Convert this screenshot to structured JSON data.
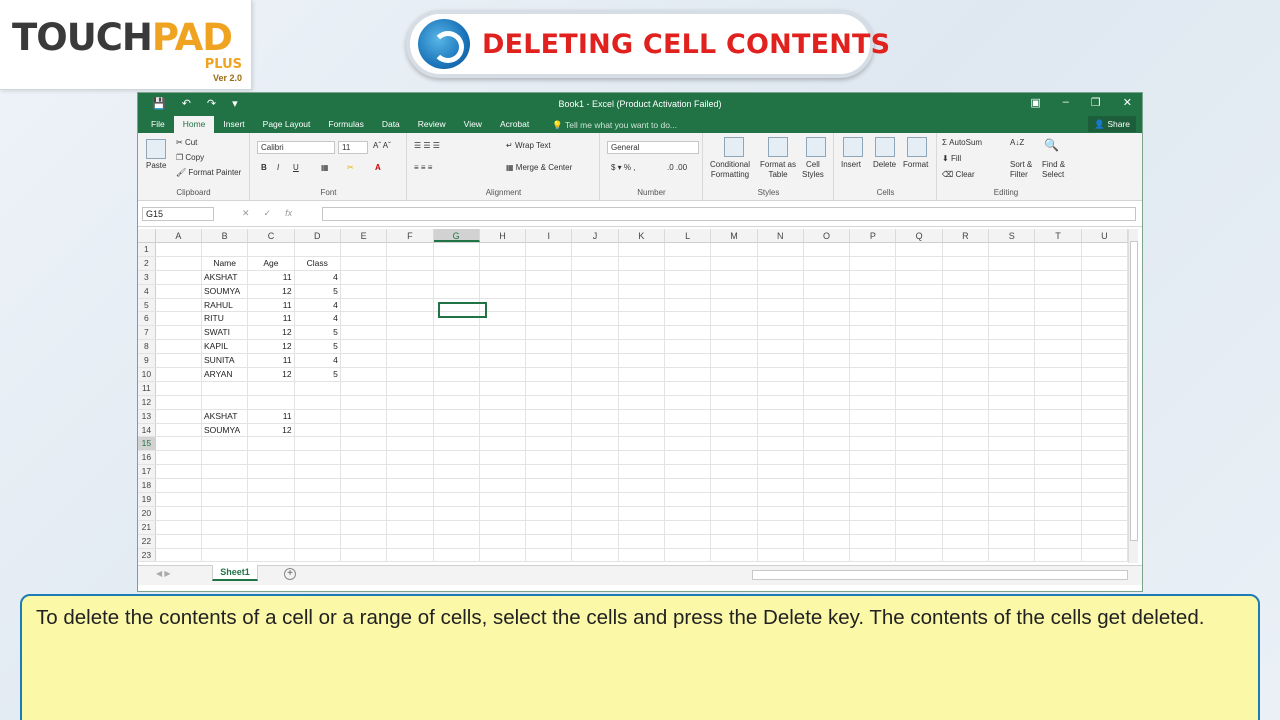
{
  "brand": {
    "logo_a": "TOUCH",
    "logo_b": "PAD",
    "plus": "PLUS",
    "version": "Ver 2.0"
  },
  "title": "DELETING CELL CONTENTS",
  "excel": {
    "window_title": "Book1 - Excel (Product Activation Failed)",
    "tabs": [
      "File",
      "Home",
      "Insert",
      "Page Layout",
      "Formulas",
      "Data",
      "Review",
      "View",
      "Acrobat"
    ],
    "tell_me": "Tell me what you want to do...",
    "share": "Share",
    "clipboard": {
      "paste": "Paste",
      "cut": "Cut",
      "copy": "Copy",
      "format_painter": "Format Painter",
      "label": "Clipboard"
    },
    "font": {
      "name": "Calibri",
      "size": "11",
      "label": "Font"
    },
    "alignment": {
      "wrap": "Wrap Text",
      "merge": "Merge & Center",
      "label": "Alignment"
    },
    "number": {
      "format": "General",
      "label": "Number"
    },
    "styles": {
      "cond": "Conditional",
      "cond2": "Formatting",
      "fmt_table": "Format as",
      "fmt_table2": "Table",
      "cell_styles": "Cell",
      "cell_styles2": "Styles",
      "label": "Styles"
    },
    "cells": {
      "insert": "Insert",
      "delete": "Delete",
      "format": "Format",
      "label": "Cells"
    },
    "editing": {
      "autosum": "AutoSum",
      "fill": "Fill",
      "clear": "Clear",
      "sort": "Sort &",
      "sort2": "Filter",
      "find": "Find &",
      "find2": "Select",
      "label": "Editing"
    },
    "name_box": "G15",
    "columns": [
      "A",
      "B",
      "C",
      "D",
      "E",
      "F",
      "G",
      "H",
      "I",
      "J",
      "K",
      "L",
      "M",
      "N",
      "O",
      "P",
      "Q",
      "R",
      "S",
      "T",
      "U"
    ],
    "rows": [
      {
        "n": "1",
        "b": "",
        "c": "",
        "d": ""
      },
      {
        "n": "2",
        "b": "Name",
        "c": "Age",
        "d": "Class"
      },
      {
        "n": "3",
        "b": "AKSHAT",
        "c": "11",
        "d": "4"
      },
      {
        "n": "4",
        "b": "SOUMYA",
        "c": "12",
        "d": "5"
      },
      {
        "n": "5",
        "b": "RAHUL",
        "c": "11",
        "d": "4"
      },
      {
        "n": "6",
        "b": "RITU",
        "c": "11",
        "d": "4"
      },
      {
        "n": "7",
        "b": "SWATI",
        "c": "12",
        "d": "5"
      },
      {
        "n": "8",
        "b": "KAPIL",
        "c": "12",
        "d": "5"
      },
      {
        "n": "9",
        "b": "SUNITA",
        "c": "11",
        "d": "4"
      },
      {
        "n": "10",
        "b": "ARYAN",
        "c": "12",
        "d": "5"
      },
      {
        "n": "11",
        "b": "",
        "c": "",
        "d": ""
      },
      {
        "n": "12",
        "b": "",
        "c": "",
        "d": ""
      },
      {
        "n": "13",
        "b": "AKSHAT",
        "c": "11",
        "d": ""
      },
      {
        "n": "14",
        "b": "SOUMYA",
        "c": "12",
        "d": ""
      },
      {
        "n": "15",
        "b": "",
        "c": "",
        "d": ""
      },
      {
        "n": "16",
        "b": "",
        "c": "",
        "d": ""
      },
      {
        "n": "17",
        "b": "",
        "c": "",
        "d": ""
      },
      {
        "n": "18",
        "b": "",
        "c": "",
        "d": ""
      },
      {
        "n": "19",
        "b": "",
        "c": "",
        "d": ""
      },
      {
        "n": "20",
        "b": "",
        "c": "",
        "d": ""
      },
      {
        "n": "21",
        "b": "",
        "c": "",
        "d": ""
      },
      {
        "n": "22",
        "b": "",
        "c": "",
        "d": ""
      },
      {
        "n": "23",
        "b": "",
        "c": "",
        "d": ""
      }
    ],
    "sheet_tab": "Sheet1"
  },
  "caption": "To delete the contents of a cell or a range of cells, select the cells and press the Delete key. The contents of the cells get deleted."
}
